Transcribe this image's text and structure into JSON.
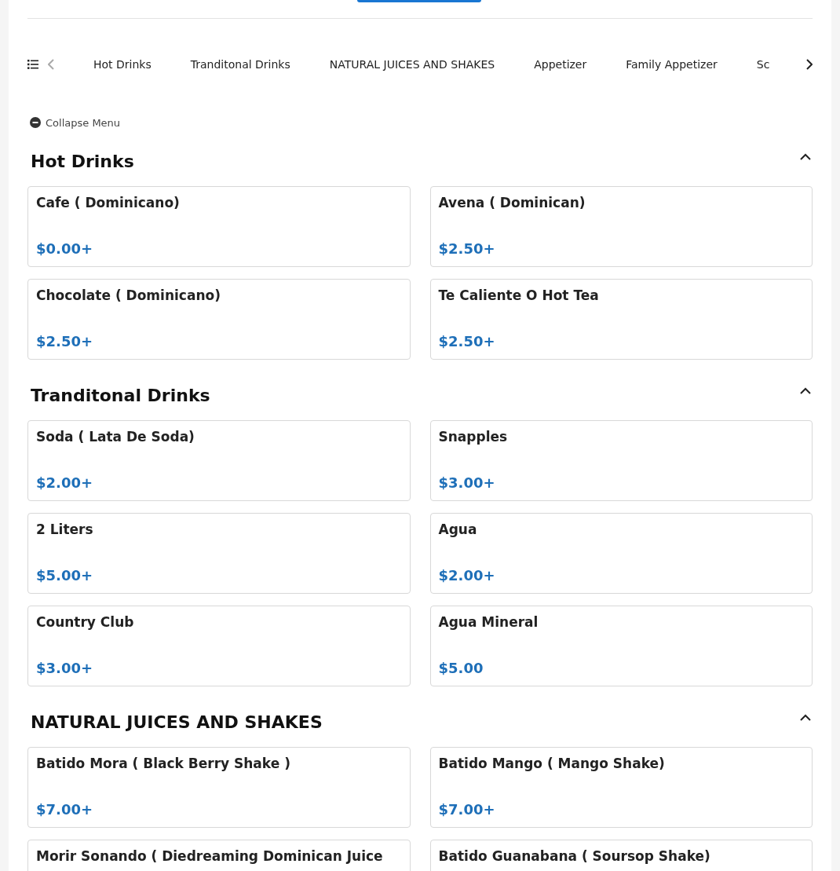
{
  "categories": [
    {
      "label": "Hot Drinks"
    },
    {
      "label": "Tranditonal Drinks"
    },
    {
      "label": "NATURAL JUICES AND SHAKES"
    },
    {
      "label": "Appetizer"
    },
    {
      "label": "Family Appetizer"
    },
    {
      "label": "Sc"
    }
  ],
  "collapse_label": "Collapse Menu",
  "sections": [
    {
      "title": "Hot Drinks",
      "expanded": true,
      "items": [
        {
          "name": "Cafe ( Dominicano)",
          "price": "$0.00+"
        },
        {
          "name": "Avena ( Dominican)",
          "price": "$2.50+"
        },
        {
          "name": "Chocolate ( Dominicano)",
          "price": "$2.50+"
        },
        {
          "name": "Te Caliente O Hot Tea",
          "price": "$2.50+"
        }
      ]
    },
    {
      "title": "Tranditonal Drinks",
      "expanded": true,
      "items": [
        {
          "name": "Soda ( Lata De Soda)",
          "price": "$2.00+"
        },
        {
          "name": "Snapples",
          "price": "$3.00+"
        },
        {
          "name": "2 Liters",
          "price": "$5.00+"
        },
        {
          "name": "Agua",
          "price": "$2.00+"
        },
        {
          "name": "Country Club",
          "price": "$3.00+"
        },
        {
          "name": "Agua Mineral",
          "price": "$5.00"
        }
      ]
    },
    {
      "title": "NATURAL JUICES AND SHAKES",
      "expanded": true,
      "items": [
        {
          "name": "Batido Mora ( Black Berry Shake )",
          "price": "$7.00+"
        },
        {
          "name": "Batido Mango ( Mango Shake)",
          "price": "$7.00+"
        },
        {
          "name": "Morir Sonando ( Diedreaming Dominican Juice"
        },
        {
          "name": "Batido Guanabana ( Soursop Shake)"
        }
      ]
    }
  ]
}
